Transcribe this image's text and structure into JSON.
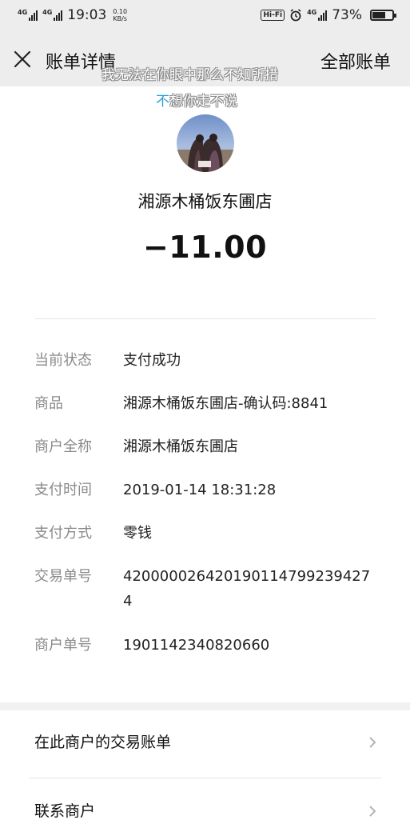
{
  "status_bar": {
    "network_1": "4G",
    "network_2": "4G",
    "time": "19:03",
    "speed_value": "0.10",
    "speed_unit": "KB/s",
    "hifi": "Hi-Fi",
    "network_3": "4G",
    "battery_percent": "73%",
    "battery_level": 0.73
  },
  "nav": {
    "title": "账单详情",
    "right_label": "全部账单"
  },
  "overlay": {
    "line_1": "我无法在你眼中那么不知所措",
    "line_2_accent": "不",
    "line_2_rest": "想你走不说"
  },
  "merchant": {
    "name": "湘源木桶饭东圃店",
    "amount": "−11.00"
  },
  "details": [
    {
      "label": "当前状态",
      "value": "支付成功"
    },
    {
      "label": "商品",
      "value": "湘源木桶饭东圃店-确认码:8841"
    },
    {
      "label": "商户全称",
      "value": "湘源木桶饭东圃店"
    },
    {
      "label": "支付时间",
      "value": "2019-01-14 18:31:28"
    },
    {
      "label": "支付方式",
      "value": "零钱"
    },
    {
      "label": "交易单号",
      "value": "4200000264201901147992394274"
    },
    {
      "label": "商户单号",
      "value": "1901142340820660"
    }
  ],
  "links": [
    {
      "label": "在此商户的交易账单"
    },
    {
      "label": "联系商户"
    }
  ],
  "icons": {
    "close": "close-icon",
    "chevron": "chevron-right-icon",
    "alarm": "alarm-icon"
  }
}
